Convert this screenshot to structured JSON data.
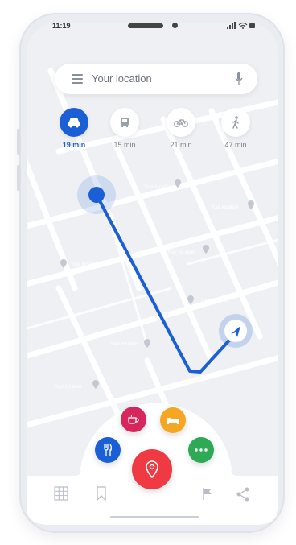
{
  "status": {
    "time": "11:19"
  },
  "search": {
    "placeholder": "Your location"
  },
  "modes": [
    {
      "name": "car",
      "label": "19 min",
      "active": true
    },
    {
      "name": "transit",
      "label": "15 min",
      "active": false
    },
    {
      "name": "bike",
      "label": "21 min",
      "active": false
    },
    {
      "name": "walk",
      "label": "47 min",
      "active": false
    }
  ],
  "map_labels": [
    "Your location",
    "Your location",
    "Your location",
    "Your location",
    "Your location",
    "Your location",
    "Your location",
    "Your location"
  ],
  "colors": {
    "accent": "#1b5fd6",
    "cafe": "#d6265b",
    "hotel": "#f5a623",
    "restaurant": "#1b5fd6",
    "more": "#2eaa56",
    "main": "#ef3a44"
  },
  "actions": [
    "coffee-icon",
    "bed-icon",
    "fork-knife-icon",
    "more-icon",
    "location-pin-icon"
  ],
  "bottom_nav": [
    "grid-icon",
    "bookmark-icon",
    "flag-icon",
    "share-icon"
  ]
}
